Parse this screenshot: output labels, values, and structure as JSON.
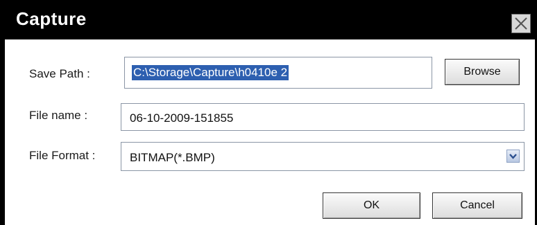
{
  "window": {
    "title": "Capture",
    "close_icon": "close-icon"
  },
  "form": {
    "save_path_label": "Save Path :",
    "save_path_value": "C:\\Storage\\Capture\\h0410e 2",
    "browse_label": "Browse",
    "file_name_label": "File name :",
    "file_name_value": "06-10-2009-151855",
    "file_format_label": "File Format :",
    "file_format_value": "BITMAP(*.BMP)",
    "dropdown_icon": "chevron-down-icon"
  },
  "buttons": {
    "ok_label": "OK",
    "cancel_label": "Cancel"
  },
  "colors": {
    "titlebar": "#000000",
    "selection": "#2d5fb0"
  }
}
